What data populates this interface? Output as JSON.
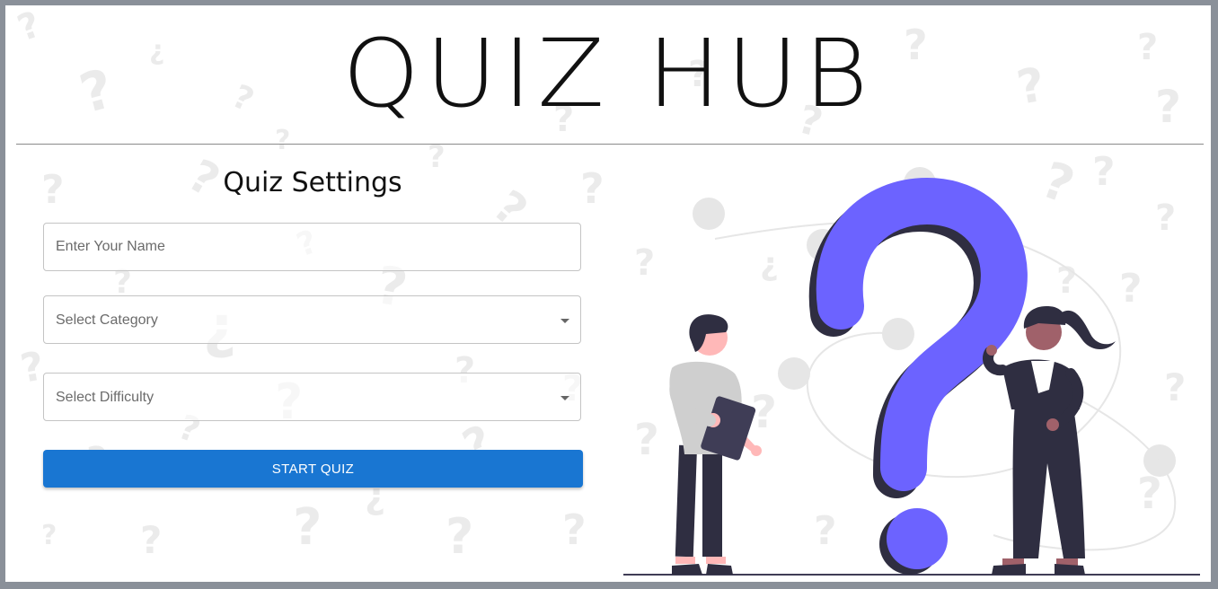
{
  "app": {
    "title": "QUIZ HUB"
  },
  "settings": {
    "heading": "Quiz Settings",
    "name_placeholder": "Enter Your Name",
    "category_label": "Select Category",
    "difficulty_label": "Select Difficulty",
    "start_label": "START QUIZ"
  },
  "colors": {
    "accent": "#1976d2",
    "question_mark": "#6c63ff",
    "dark": "#2f2e41",
    "frame": "#8a9099"
  },
  "icons": {
    "category_dropdown": "chevron-down-icon",
    "difficulty_dropdown": "chevron-down-icon"
  }
}
